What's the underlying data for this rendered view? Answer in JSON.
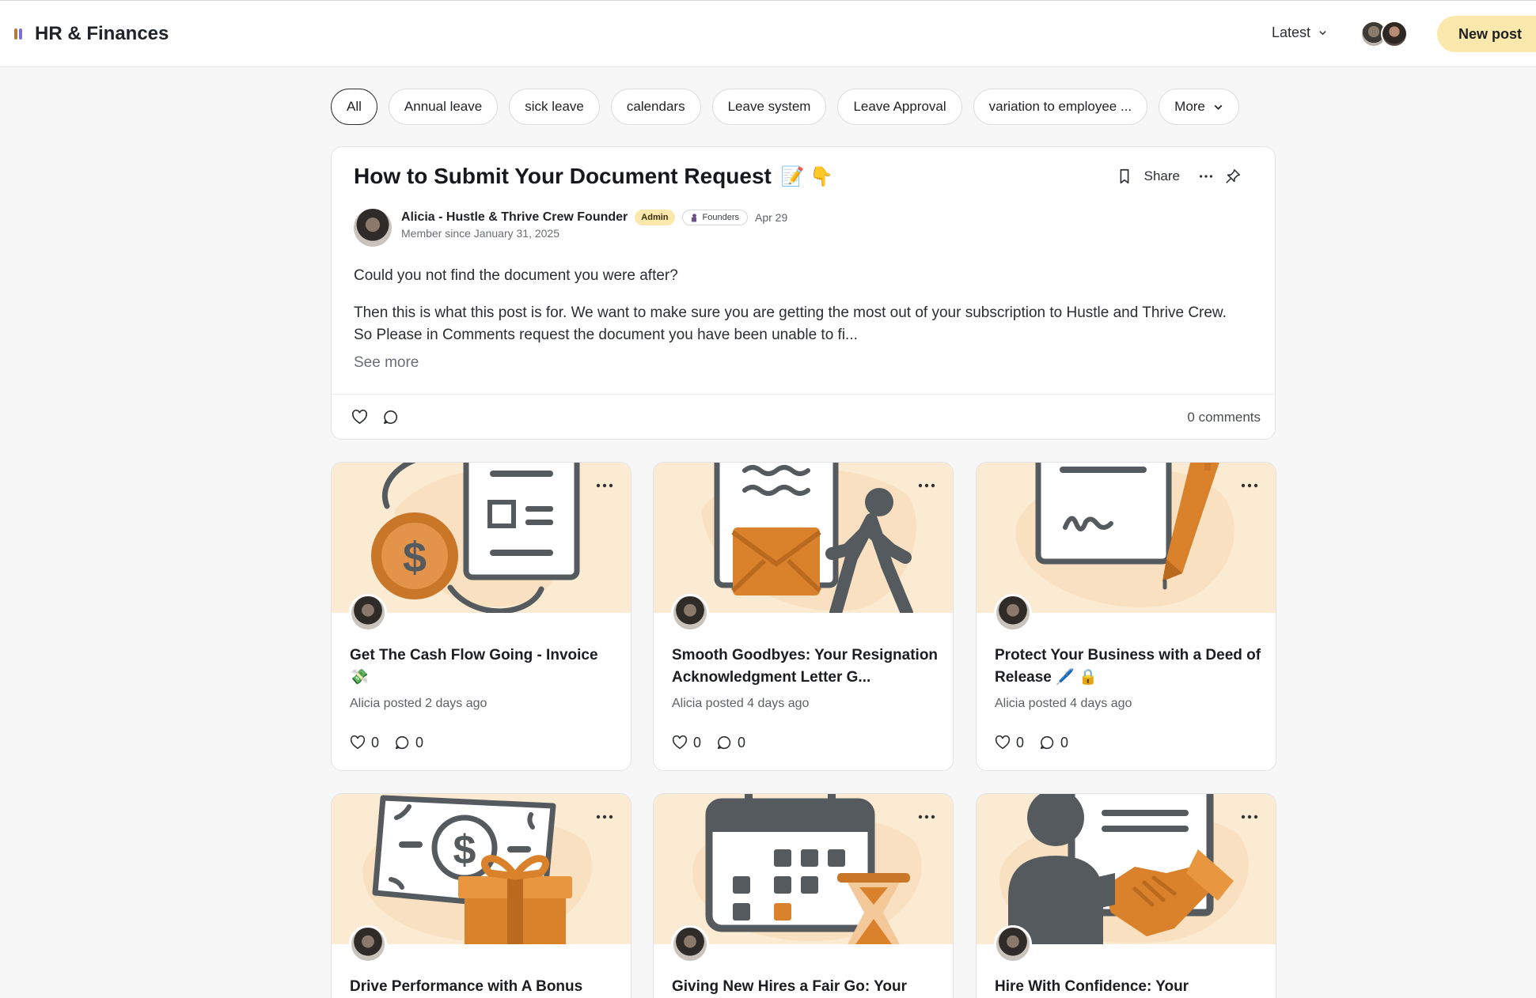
{
  "header": {
    "community_title": "HR & Finances",
    "sort_label": "Latest",
    "new_post_label": "New post"
  },
  "filters": [
    "All",
    "Annual leave",
    "sick leave",
    "calendars",
    "Leave system",
    "Leave Approval",
    "variation to employee ...",
    "More"
  ],
  "featured": {
    "title": "How to Submit Your Document Request",
    "title_emoji": "📝 👇",
    "share_label": "Share",
    "author_name": "Alicia - Hustle & Thrive Crew Founder",
    "admin_badge": "Admin",
    "founders_badge": "Founders",
    "date": "Apr 29",
    "member_since": "Member since January 31, 2025",
    "paragraph1": "Could you not find the document you were after?",
    "paragraph2": "Then this is what this post is for. We want to make sure you are getting the most out of your subscription to Hustle and Thrive Crew. So Please in Comments request the document you have been unable to fi...",
    "see_more": "See more",
    "comments_count": "0 comments"
  },
  "cards": [
    {
      "title": "Get The Cash Flow Going - Invoice 💸",
      "meta": "Alicia posted 2 days ago",
      "likes": "0",
      "comments": "0",
      "icon": "invoice-illustration"
    },
    {
      "title": "Smooth Goodbyes: Your Resignation Acknowledgment Letter G...",
      "meta": "Alicia posted 4 days ago",
      "likes": "0",
      "comments": "0",
      "icon": "resignation-illustration"
    },
    {
      "title": "Protect Your Business with a Deed of Release 🖊️ 🔒",
      "meta": "Alicia posted 4 days ago",
      "likes": "0",
      "comments": "0",
      "icon": "deed-illustration"
    },
    {
      "title": "Drive Performance with A Bonus",
      "meta": "",
      "likes": "",
      "comments": "",
      "icon": "bonus-illustration"
    },
    {
      "title": "Giving New Hires a Fair Go: Your",
      "meta": "",
      "likes": "",
      "comments": "",
      "icon": "calendar-illustration"
    },
    {
      "title": "Hire With Confidence: Your",
      "meta": "",
      "likes": "",
      "comments": "",
      "icon": "handshake-illustration"
    }
  ],
  "colors": {
    "accent": "#fbe8ac",
    "thumb_bg": "#fcebd3",
    "illustration_orange": "#d9822b",
    "illustration_gray": "#555a5e"
  }
}
